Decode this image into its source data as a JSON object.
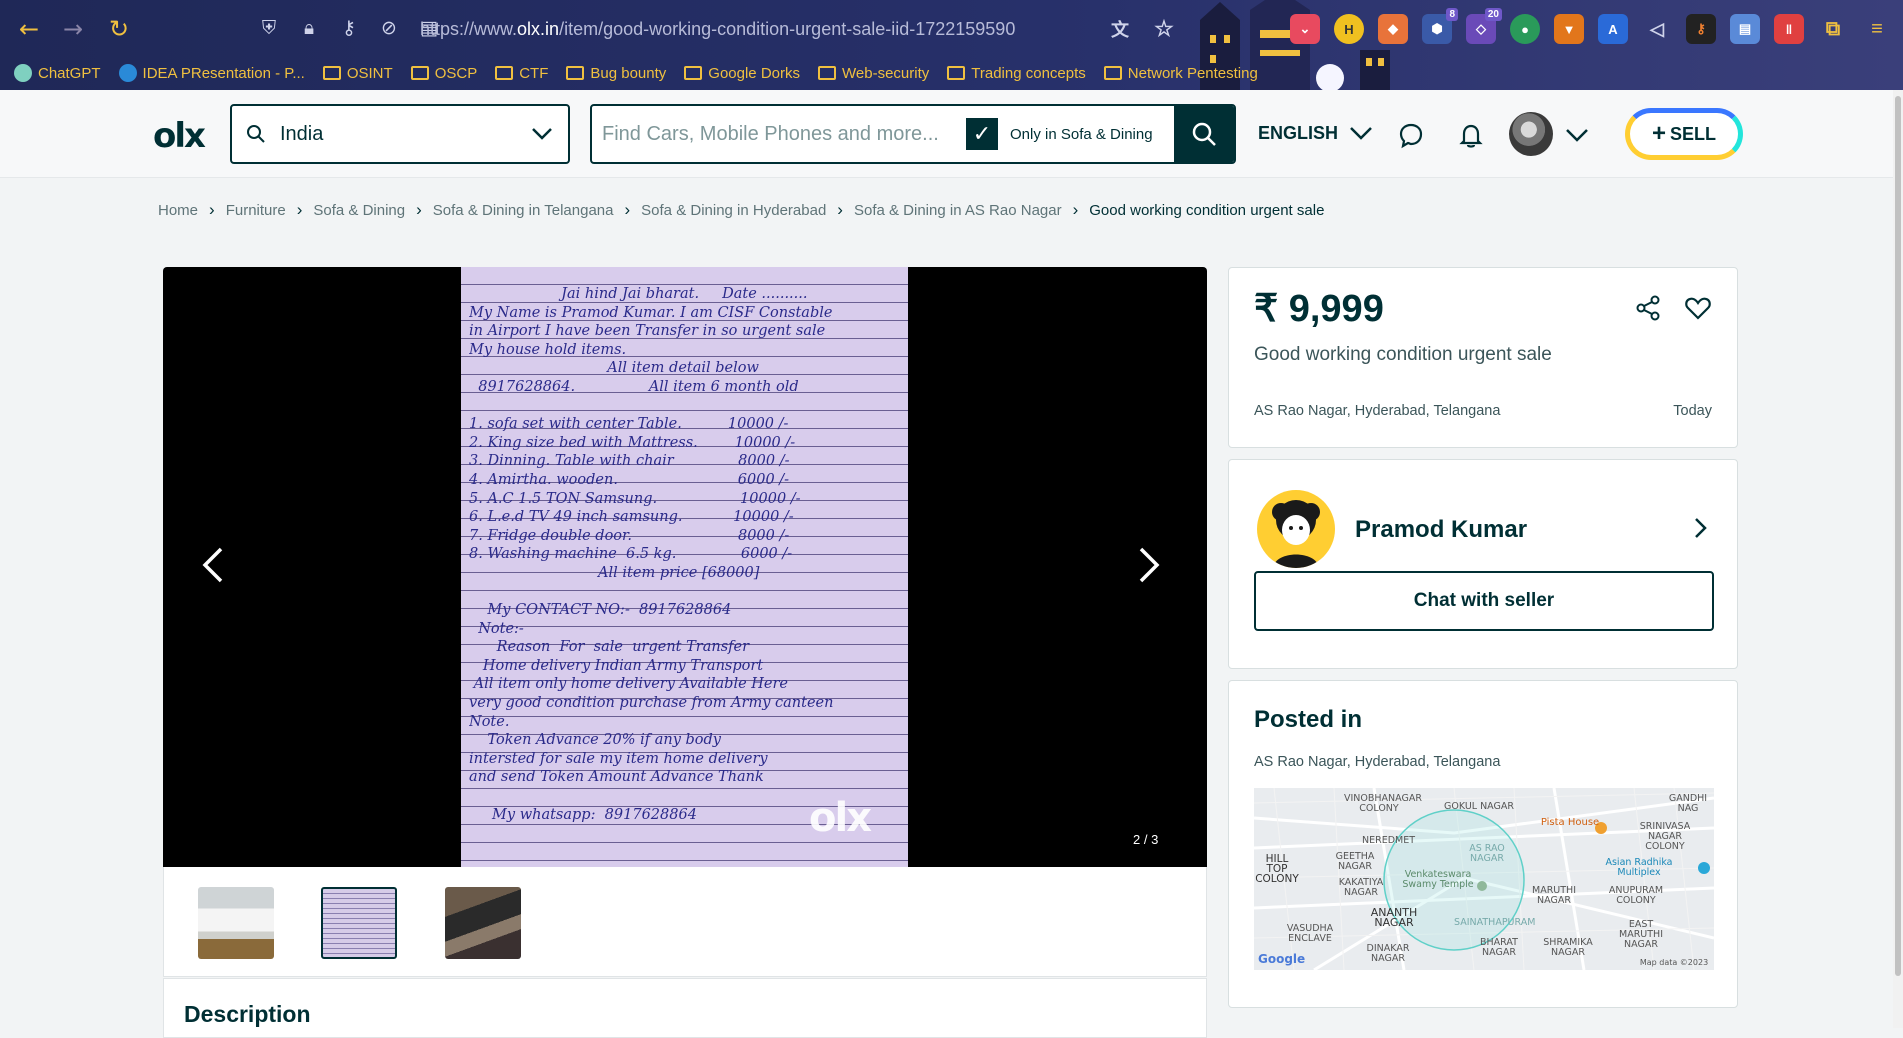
{
  "browser": {
    "url_prefix": "https://www.",
    "url_domain": "olx.in",
    "url_path": "/item/good-working-condition-urgent-sale-iid-1722159590",
    "extension_badges": [
      "8",
      "20"
    ],
    "bookmarks": [
      "ChatGPT",
      "IDEA PResentation - P...",
      "OSINT",
      "OSCP",
      "CTF",
      "Bug bounty",
      "Google Dorks",
      "Web-security",
      "Trading concepts",
      "Network Pentesting"
    ]
  },
  "header": {
    "logo": "olx",
    "location": "India",
    "search_placeholder": "Find Cars, Mobile Phones and more...",
    "only_in_label": "Only in Sofa & Dining",
    "language": "ENGLISH",
    "sell_label": "SELL"
  },
  "breadcrumb": [
    "Home",
    "Furniture",
    "Sofa & Dining",
    "Sofa & Dining in Telangana",
    "Sofa & Dining in Hyderabad",
    "Sofa & Dining in AS Rao Nagar",
    "Good working condition urgent sale"
  ],
  "gallery": {
    "counter": "2 / 3",
    "watermark": "olx",
    "note_lines": [
      "                    Jai hind Jai bharat.     Date ..........",
      "My Name is Pramod Kumar. I am CISF Constable",
      "in Airport I have been Transfer in so urgent sale",
      "My house hold items.",
      "                              All item detail below",
      "  8917628864.                All item 6 month old",
      "",
      "1. sofa set with center Table.          10000 /-",
      "2. King size bed with Mattress.        10000 /-",
      "3. Dinning. Table with chair              8000 /-",
      "4. Amirtha. wooden.                          6000 /-",
      "5. A.C 1.5 TON Samsung.                  10000 /-",
      "6. L.e.d TV 49 inch samsung.           10000 /-",
      "7. Fridge double door.                       8000 /-",
      "8. Washing machine  6.5 kg.              6000 /-",
      "                            All item price [68000]",
      "",
      "    My CONTACT NO:-  8917628864",
      "  Note:-",
      "      Reason  For  sale  urgent Transfer",
      "   Home delivery Indian Army Transport",
      " All item only home delivery Available Here",
      "very good condition purchase from Army canteen",
      "Note.",
      "    Token Advance 20% if any body",
      "intersted for sale my item home delivery",
      "and send Token Amount Advance Thank",
      "",
      "     My whatsapp:  8917628864"
    ]
  },
  "description_title": "Description",
  "ad": {
    "price": "₹ 9,999",
    "title": "Good working condition urgent sale",
    "location": "AS Rao Nagar, Hyderabad, Telangana",
    "date": "Today"
  },
  "seller": {
    "name": "Pramod Kumar",
    "chat_label": "Chat with seller"
  },
  "posted": {
    "title": "Posted in",
    "location": "AS Rao Nagar, Hyderabad, Telangana"
  },
  "map": {
    "labels": [
      "VINOBHANAGAR COLONY",
      "GOKUL NAGAR",
      "Pista House",
      "SRINIVASA NAGAR COLONY",
      "GANDHI NAG",
      "HILL TOP COLONY",
      "NEREDMET",
      "GEETHA NAGAR",
      "AS RAO NAGAR",
      "Asian Radhika Multiplex",
      "KAKATIYA NAGAR",
      "Venkateswara Swamy Temple",
      "MARUTHI NAGAR",
      "ANUPURAM COLONY",
      "ANANTH NAGAR",
      "SAINATHAPURAM",
      "VASUDHA ENCLAVE",
      "DINAKAR NAGAR",
      "BHARAT NAGAR",
      "SHRAMIKA NAGAR",
      "EAST MARUTHI NAGAR"
    ],
    "google": "Google",
    "attribution": "Map data ©2023"
  }
}
